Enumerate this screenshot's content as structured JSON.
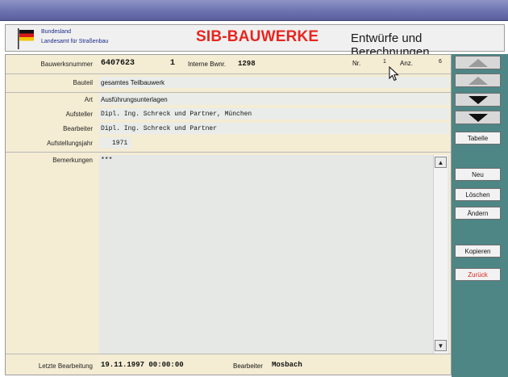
{
  "header": {
    "org_line1": "Bundesland",
    "org_line2": "Landesamt für Straßenbau",
    "app_title": "SIB-BAUWERKE",
    "section_title": "Entwürfe und Berechnungen"
  },
  "record": {
    "bauwerksnummer_label": "Bauwerksnummer",
    "bauwerksnummer": "6407623",
    "teil_nr": "1",
    "interne_bwnr_label": "Interne Bwnr.",
    "interne_bwnr": "1298",
    "nr_label": "Nr.",
    "nr": "1",
    "anz_label": "Anz.",
    "anz": "6",
    "bauteil_label": "Bauteil",
    "bauteil": "gesamtes Teilbauwerk",
    "art_label": "Art",
    "art": "Ausführungsunterlagen",
    "aufsteller_label": "Aufsteller",
    "aufsteller": "Dipl. Ing. Schreck und Partner, München",
    "bearbeiter_label": "Bearbeiter",
    "bearbeiter": "Dipl. Ing. Schreck und Partner",
    "aufstellungsjahr_label": "Aufstellungsjahr",
    "aufstellungsjahr": "1971",
    "bemerkungen_label": "Bemerkungen",
    "bemerkungen": "***"
  },
  "footer": {
    "letzte_bearbeitung_label": "Letzte Bearbeitung",
    "letzte_bearbeitung": "19.11.1997 00:00:00",
    "bearbeiter_label": "Bearbeiter",
    "bearbeiter": "Mosbach"
  },
  "sidebar": {
    "tabelle": "Tabelle",
    "neu": "Neu",
    "loeschen": "Löschen",
    "aendern": "Ändern",
    "kopieren": "Kopieren",
    "zurueck": "Zurück"
  },
  "colors": {
    "title_red": "#e8251f",
    "panel_beige": "#f4ecd3",
    "sidebar_teal": "#4e8585"
  }
}
